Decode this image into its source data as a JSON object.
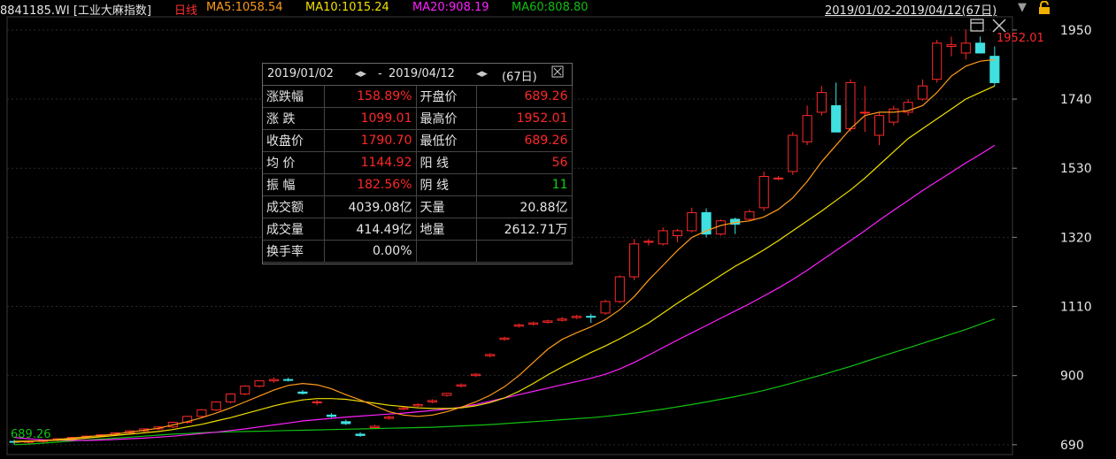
{
  "header": {
    "code": "8841185.WI",
    "name": "[工业大麻指数]",
    "period": "日线",
    "ma5": "MA5:1058.54",
    "ma10": "MA10:1015.24",
    "ma20": "MA20:908.19",
    "ma60": "MA60:808.80",
    "date_range": "2019/01/02-2019/04/12(67日)"
  },
  "colors": {
    "ma5": "#ff9a1a",
    "ma10": "#f0e000",
    "ma20": "#ff20ff",
    "ma60": "#10c010",
    "up": "#ff2828",
    "down": "#40e0e0",
    "grid": "#2a2a2a"
  },
  "markers": {
    "high_label": "1952.01",
    "low_label": "689.26"
  },
  "stats": {
    "start": "2019/01/02",
    "end": "2019/04/12",
    "days": "(67日)",
    "rows": [
      [
        {
          "l": "涨跌幅",
          "v": "158.89%",
          "c": "red"
        },
        {
          "l": "开盘价",
          "v": "689.26",
          "c": "red"
        }
      ],
      [
        {
          "l": "涨  跌",
          "v": "1099.01",
          "c": "red"
        },
        {
          "l": "最高价",
          "v": "1952.01",
          "c": "red"
        }
      ],
      [
        {
          "l": "收盘价",
          "v": "1790.70",
          "c": "red"
        },
        {
          "l": "最低价",
          "v": "689.26",
          "c": "red"
        }
      ],
      [
        {
          "l": "均  价",
          "v": "1144.92",
          "c": "red"
        },
        {
          "l": "阳  线",
          "v": "56",
          "c": "red"
        }
      ],
      [
        {
          "l": "振  幅",
          "v": "182.56%",
          "c": "red"
        },
        {
          "l": "阴  线",
          "v": "11",
          "c": "green"
        }
      ],
      [
        {
          "l": "成交额",
          "v": "4039.08亿",
          "c": "white"
        },
        {
          "l": "天量",
          "v": "20.88亿",
          "c": "white"
        }
      ],
      [
        {
          "l": "成交量",
          "v": "414.49亿",
          "c": "white"
        },
        {
          "l": "地量",
          "v": "2612.71万",
          "c": "white"
        }
      ],
      [
        {
          "l": "换手率",
          "v": "0.00%",
          "c": "white"
        },
        {
          "l": "",
          "v": "",
          "c": "white"
        }
      ]
    ]
  },
  "chart_data": {
    "type": "candlestick",
    "y_ticks": [
      690,
      900,
      1110,
      1320,
      1530,
      1740,
      1950
    ],
    "ylim": [
      660,
      1990
    ],
    "candles": [
      [
        700,
        705,
        690,
        698
      ],
      [
        698,
        703,
        693,
        700
      ],
      [
        700,
        706,
        696,
        704
      ],
      [
        704,
        710,
        700,
        708
      ],
      [
        708,
        714,
        704,
        712
      ],
      [
        712,
        718,
        708,
        716
      ],
      [
        716,
        722,
        712,
        720
      ],
      [
        720,
        728,
        716,
        726
      ],
      [
        726,
        734,
        722,
        732
      ],
      [
        732,
        740,
        728,
        738
      ],
      [
        738,
        746,
        734,
        744
      ],
      [
        744,
        760,
        740,
        758
      ],
      [
        758,
        778,
        754,
        776
      ],
      [
        776,
        798,
        772,
        796
      ],
      [
        796,
        822,
        792,
        820
      ],
      [
        820,
        846,
        816,
        844
      ],
      [
        844,
        870,
        840,
        868
      ],
      [
        868,
        886,
        864,
        884
      ],
      [
        884,
        894,
        878,
        888
      ],
      [
        888,
        894,
        882,
        886
      ],
      [
        850,
        856,
        842,
        846
      ],
      [
        818,
        826,
        810,
        820
      ],
      [
        780,
        786,
        772,
        776
      ],
      [
        760,
        766,
        750,
        754
      ],
      [
        722,
        728,
        714,
        718
      ],
      [
        742,
        750,
        738,
        746
      ],
      [
        770,
        778,
        766,
        774
      ],
      [
        798,
        806,
        794,
        802
      ],
      [
        808,
        816,
        804,
        812
      ],
      [
        820,
        828,
        816,
        824
      ],
      [
        840,
        848,
        836,
        846
      ],
      [
        868,
        876,
        864,
        872
      ],
      [
        900,
        908,
        896,
        904
      ],
      [
        960,
        968,
        956,
        964
      ],
      [
        1010,
        1018,
        1006,
        1014
      ],
      [
        1050,
        1058,
        1046,
        1054
      ],
      [
        1056,
        1064,
        1052,
        1060
      ],
      [
        1062,
        1070,
        1058,
        1066
      ],
      [
        1068,
        1078,
        1064,
        1072
      ],
      [
        1076,
        1084,
        1072,
        1080
      ],
      [
        1080,
        1088,
        1060,
        1078
      ],
      [
        1090,
        1130,
        1085,
        1125
      ],
      [
        1125,
        1205,
        1120,
        1200
      ],
      [
        1200,
        1315,
        1190,
        1300
      ],
      [
        1305,
        1315,
        1295,
        1308
      ],
      [
        1300,
        1350,
        1295,
        1340
      ],
      [
        1325,
        1345,
        1305,
        1340
      ],
      [
        1340,
        1410,
        1335,
        1395
      ],
      [
        1395,
        1408,
        1320,
        1330
      ],
      [
        1330,
        1375,
        1325,
        1370
      ],
      [
        1375,
        1380,
        1330,
        1360
      ],
      [
        1375,
        1405,
        1370,
        1398
      ],
      [
        1410,
        1520,
        1400,
        1505
      ],
      [
        1500,
        1506,
        1494,
        1500
      ],
      [
        1520,
        1640,
        1510,
        1630
      ],
      [
        1610,
        1720,
        1600,
        1690
      ],
      [
        1700,
        1780,
        1690,
        1760
      ],
      [
        1720,
        1790,
        1640,
        1640
      ],
      [
        1650,
        1800,
        1640,
        1790
      ],
      [
        1700,
        1780,
        1640,
        1700
      ],
      [
        1630,
        1700,
        1600,
        1690
      ],
      [
        1670,
        1720,
        1660,
        1710
      ],
      [
        1700,
        1740,
        1690,
        1730
      ],
      [
        1740,
        1800,
        1735,
        1780
      ],
      [
        1800,
        1920,
        1790,
        1910
      ],
      [
        1900,
        1930,
        1870,
        1905
      ],
      [
        1880,
        1952,
        1860,
        1910
      ],
      [
        1910,
        1930,
        1890,
        1880
      ],
      [
        1870,
        1900,
        1780,
        1790
      ]
    ],
    "ma5": [
      698,
      700,
      702,
      706,
      710,
      714,
      718,
      722,
      728,
      734,
      740,
      750,
      760,
      772,
      786,
      802,
      820,
      838,
      856,
      870,
      876,
      872,
      860,
      842,
      826,
      808,
      790,
      780,
      776,
      780,
      790,
      804,
      820,
      840,
      866,
      900,
      940,
      980,
      1010,
      1030,
      1048,
      1070,
      1100,
      1140,
      1190,
      1235,
      1280,
      1320,
      1340,
      1356,
      1365,
      1370,
      1382,
      1405,
      1440,
      1490,
      1550,
      1600,
      1650,
      1690,
      1700,
      1700,
      1705,
      1720,
      1760,
      1810,
      1840,
      1855,
      1860
    ],
    "ma10": [
      700,
      701,
      702,
      704,
      706,
      710,
      714,
      718,
      722,
      726,
      730,
      736,
      744,
      752,
      762,
      772,
      784,
      796,
      808,
      818,
      826,
      830,
      830,
      828,
      822,
      816,
      810,
      806,
      802,
      800,
      800,
      802,
      808,
      818,
      832,
      852,
      876,
      902,
      926,
      948,
      970,
      990,
      1012,
      1035,
      1060,
      1090,
      1120,
      1148,
      1176,
      1204,
      1232,
      1256,
      1282,
      1310,
      1340,
      1370,
      1400,
      1432,
      1464,
      1500,
      1540,
      1580,
      1620,
      1650,
      1680,
      1710,
      1740,
      1760,
      1780
    ],
    "ma20": [
      712,
      708,
      705,
      704,
      703,
      703,
      704,
      706,
      708,
      710,
      713,
      716,
      720,
      724,
      728,
      733,
      738,
      744,
      750,
      756,
      762,
      766,
      770,
      774,
      777,
      780,
      783,
      786,
      790,
      794,
      798,
      804,
      812,
      822,
      832,
      842,
      852,
      862,
      872,
      882,
      892,
      904,
      920,
      940,
      962,
      985,
      1008,
      1030,
      1052,
      1074,
      1096,
      1118,
      1142,
      1166,
      1192,
      1220,
      1250,
      1280,
      1310,
      1340,
      1372,
      1402,
      1432,
      1462,
      1490,
      1518,
      1546,
      1572,
      1600
    ],
    "ma60": [
      690,
      692,
      695,
      698,
      701,
      704,
      707,
      710,
      713,
      716,
      719,
      722,
      724,
      726,
      728,
      729,
      730,
      731,
      732,
      733,
      734,
      735,
      736,
      737,
      738,
      739,
      740,
      741,
      742,
      743,
      745,
      747,
      749,
      751,
      754,
      757,
      760,
      763,
      766,
      769,
      772,
      776,
      781,
      786,
      792,
      798,
      805,
      812,
      820,
      828,
      836,
      845,
      855,
      866,
      878,
      890,
      902,
      915,
      928,
      942,
      956,
      970,
      984,
      998,
      1012,
      1026,
      1040,
      1056,
      1072
    ]
  }
}
